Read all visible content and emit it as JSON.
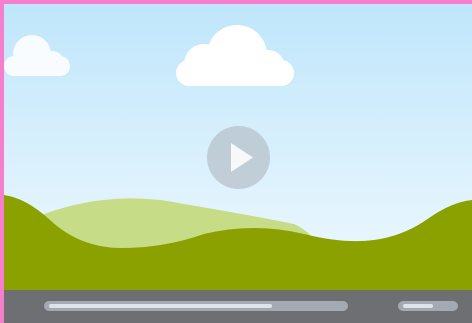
{
  "player": {
    "state": "paused",
    "progress": 0.76,
    "volume": 0.6,
    "icons": {
      "play": "play-icon"
    },
    "colors": {
      "frame_border": "#f57fcd",
      "sky_top": "#bfe6fb",
      "sky_bottom": "#f0f9fe",
      "hill_front": "#8aa100",
      "hill_back": "#c7dc86",
      "cloud": "#ffffff",
      "control_bar": "#6d6f73",
      "track": "#a4aab3",
      "track_fill": "#dfe4ea",
      "play_button": "#b0b8c0"
    }
  }
}
